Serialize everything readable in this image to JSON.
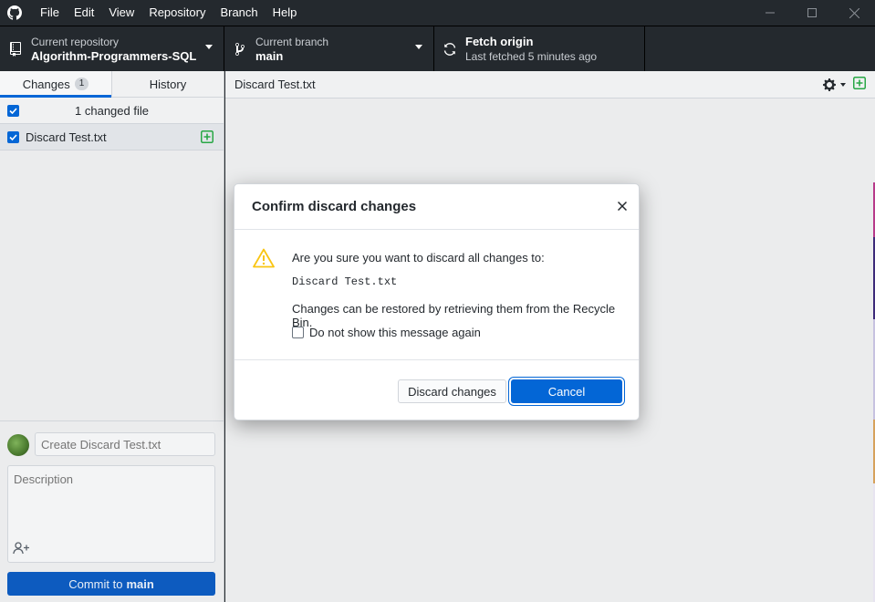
{
  "menu": [
    "File",
    "Edit",
    "View",
    "Repository",
    "Branch",
    "Help"
  ],
  "toolbar": {
    "repo_label": "Current repository",
    "repo_value": "Algorithm-Programmers-SQL",
    "branch_label": "Current branch",
    "branch_value": "main",
    "fetch_label": "Fetch origin",
    "fetch_sub": "Last fetched 5 minutes ago"
  },
  "sidebar": {
    "tabs": [
      {
        "label": "Changes",
        "count": "1"
      },
      {
        "label": "History"
      }
    ],
    "changed_header": "1 changed file",
    "files": [
      {
        "name": "Discard Test.txt"
      }
    ]
  },
  "commit": {
    "summary_placeholder": "Create Discard Test.txt",
    "description_placeholder": "Description",
    "button_prefix": "Commit to",
    "button_branch": "main"
  },
  "diff": {
    "file_name": "Discard Test.txt"
  },
  "dialog": {
    "title": "Confirm discard changes",
    "message": "Are you sure you want to discard all changes to:",
    "file_path": "Discard Test.txt",
    "restore_note": "Changes can be restored by retrieving them from the Recycle Bin.",
    "checkbox_label": "Do not show this message again",
    "discard_label": "Discard changes",
    "cancel_label": "Cancel"
  },
  "colors": {
    "accent": "#0366d6",
    "titlebar": "#24292e",
    "added": "#28a745",
    "warning": "#f9c513"
  }
}
